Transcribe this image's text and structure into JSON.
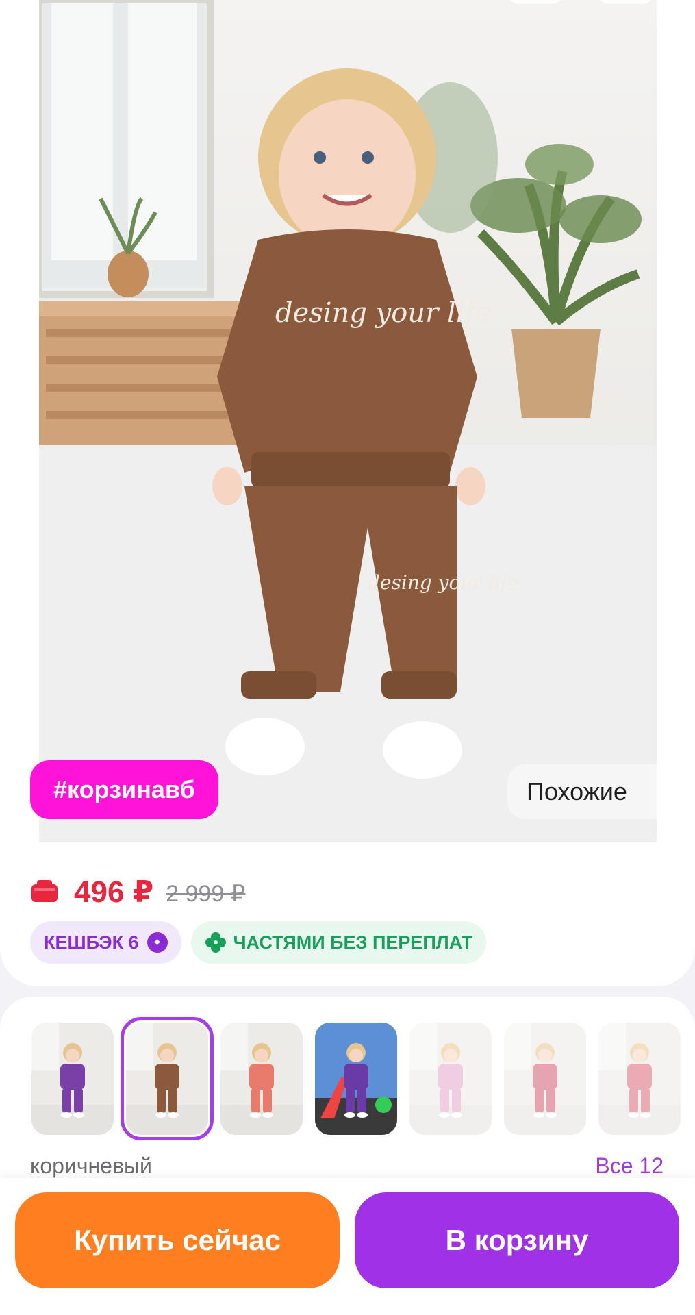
{
  "product": {
    "tag": "#корзинавб",
    "similar_label": "Похожие",
    "price": "496 ₽",
    "old_price": "2 999 ₽",
    "cashback_label": "КЕШБЭК 6",
    "installments_label": "ЧАСТЯМИ БЕЗ ПЕРЕПЛАТ",
    "print_text": "desing your life"
  },
  "variants": {
    "selected_color": "коричневый",
    "all_label": "Все 12",
    "thumbnails": [
      {
        "color": "purple",
        "hex": "#7b3fa8",
        "selected": false
      },
      {
        "color": "brown",
        "hex": "#8b5a3c",
        "selected": true
      },
      {
        "color": "coral",
        "hex": "#e87b6c",
        "selected": false
      },
      {
        "color": "playground",
        "hex": "#6a3aa6",
        "selected": false
      },
      {
        "color": "pink",
        "hex": "#e5a6c8",
        "selected": false
      },
      {
        "color": "raspberry",
        "hex": "#d35a72",
        "selected": false
      },
      {
        "color": "white-red",
        "hex": "#d9687a",
        "selected": false
      }
    ]
  },
  "actions": {
    "buy_now": "Купить сейчас",
    "add_to_cart": "В корзину"
  },
  "colors": {
    "tag_bg": "#ff13d8",
    "price": "#e8273f",
    "buy_button": "#ff7e1f",
    "cart_button": "#9f32e6",
    "accent_purple": "#a43ee8",
    "installments_green": "#16a05a"
  }
}
